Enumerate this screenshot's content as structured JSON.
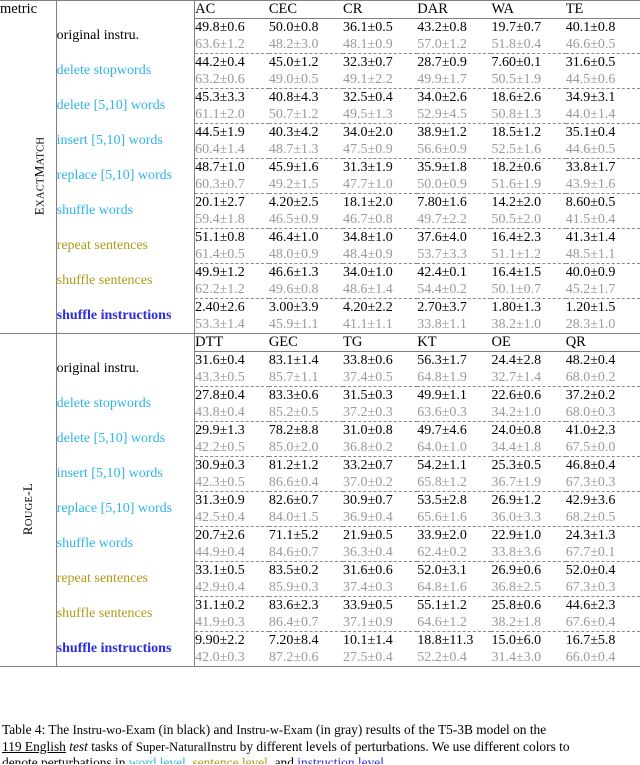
{
  "table": {
    "metric_header_label": "metric",
    "sections": [
      {
        "metric_label": "ExactMatch",
        "columns": [
          "AC",
          "CEC",
          "CR",
          "DAR",
          "WA",
          "TE"
        ],
        "rows": [
          {
            "label": "original instru.",
            "level": "none",
            "black": [
              "49.8±0.6",
              "50.0±0.8",
              "36.1±0.5",
              "43.2±0.8",
              "19.7±0.7",
              "40.1±0.8"
            ],
            "gray": [
              "63.6±1.2",
              "48.2±3.0",
              "48.1±0.9",
              "57.0±1.2",
              "51.8±0.4",
              "46.6±0.5"
            ]
          },
          {
            "label": "delete stopwords",
            "level": "word",
            "black": [
              "44.2±0.4",
              "45.0±1.2",
              "32.3±0.7",
              "28.7±0.9",
              "7.60±0.1",
              "31.6±0.5"
            ],
            "gray": [
              "63.2±0.6",
              "49.0±0.5",
              "49.1±2.2",
              "49.9±1.7",
              "50.5±1.9",
              "44.5±0.6"
            ]
          },
          {
            "label": "delete [5,10] words",
            "level": "word",
            "black": [
              "45.3±3.3",
              "40.8±4.3",
              "32.5±0.4",
              "34.0±2.6",
              "18.6±2.6",
              "34.9±3.1"
            ],
            "gray": [
              "61.1±2.0",
              "50.7±1.2",
              "49.5±1.3",
              "52.9±4.5",
              "50.8±1.3",
              "44.0±1.4"
            ]
          },
          {
            "label": "insert [5,10] words",
            "level": "word",
            "black": [
              "44.5±1.9",
              "40.3±4.2",
              "34.0±2.0",
              "38.9±1.2",
              "18.5±1.2",
              "35.1±0.4"
            ],
            "gray": [
              "60.4±1.4",
              "48.7±1.3",
              "47.5±0.9",
              "56.6±0.9",
              "52.5±1.6",
              "44.6±0.5"
            ]
          },
          {
            "label": "replace [5,10] words",
            "level": "word",
            "black": [
              "48.7±1.0",
              "45.9±1.6",
              "31.3±1.9",
              "35.9±1.8",
              "18.2±0.6",
              "33.8±1.7"
            ],
            "gray": [
              "60.3±0.7",
              "49.2±1.5",
              "47.7±1.0",
              "50.0±0.9",
              "51.6±1.9",
              "43.9±1.6"
            ]
          },
          {
            "label": "shuffle words",
            "level": "word",
            "black": [
              "20.1±2.7",
              "4.20±2.5",
              "18.1±2.0",
              "7.80±1.6",
              "14.2±2.0",
              "8.60±0.5"
            ],
            "gray": [
              "59.4±1.8",
              "46.5±0.9",
              "46.7±0.8",
              "49.7±2.2",
              "50.5±2.0",
              "41.5±0.4"
            ]
          },
          {
            "label": "repeat sentences",
            "level": "sent",
            "black": [
              "51.1±0.8",
              "46.4±1.0",
              "34.8±1.0",
              "37.6±4.0",
              "16.4±2.3",
              "41.3±1.4"
            ],
            "gray": [
              "61.4±0.5",
              "48.0±0.9",
              "48.4±0.9",
              "53.7±3.3",
              "51.1±1.2",
              "48.5±1.1"
            ]
          },
          {
            "label": "shuffle sentences",
            "level": "sent",
            "black": [
              "49.9±1.2",
              "46.6±1.3",
              "34.0±1.0",
              "42.4±0.1",
              "16.4±1.5",
              "40.0±0.9"
            ],
            "gray": [
              "62.2±1.2",
              "49.6±0.8",
              "48.6±1.4",
              "54.4±0.2",
              "50.1±0.7",
              "45.2±1.7"
            ]
          },
          {
            "label": "shuffle instructions",
            "level": "instr",
            "black": [
              "2.40±2.6",
              "3.00±3.9",
              "4.20±2.2",
              "2.70±3.7",
              "1.80±1.3",
              "1.20±1.5"
            ],
            "gray": [
              "53.3±1.4",
              "45.9±1.1",
              "41.1±1.1",
              "33.8±1.1",
              "38.2±1.0",
              "28.3±1.0"
            ]
          }
        ]
      },
      {
        "metric_label": "Rouge-L",
        "columns": [
          "DTT",
          "GEC",
          "TG",
          "KT",
          "OE",
          "QR"
        ],
        "rows": [
          {
            "label": "original instru.",
            "level": "none",
            "black": [
              "31.6±0.4",
              "83.1±1.4",
              "33.8±0.6",
              "56.3±1.7",
              "24.4±2.8",
              "48.2±0.4"
            ],
            "gray": [
              "43.3±0.5",
              "85.7±1.1",
              "37.4±0.5",
              "64.8±1.9",
              "32.7±1.4",
              "68.0±0.2"
            ]
          },
          {
            "label": "delete stopwords",
            "level": "word",
            "black": [
              "27.8±0.4",
              "83.3±0.6",
              "31.5±0.3",
              "49.9±1.1",
              "22.6±0.6",
              "37.2±0.2"
            ],
            "gray": [
              "43.8±0.4",
              "85.2±0.5",
              "37.2±0.3",
              "63.6±0.3",
              "34.2±1.0",
              "68.0±0.3"
            ]
          },
          {
            "label": "delete [5,10] words",
            "level": "word",
            "black": [
              "29.9±1.3",
              "78.2±8.8",
              "31.0±0.8",
              "49.7±4.6",
              "24.0±0.8",
              "41.0±2.3"
            ],
            "gray": [
              "42.2±0.5",
              "85.0±2.0",
              "36.8±0.2",
              "64.0±1.0",
              "34.4±1.8",
              "67.5±0.0"
            ]
          },
          {
            "label": "insert [5,10] words",
            "level": "word",
            "black": [
              "30.9±0.3",
              "81.2±1.2",
              "33.2±0.7",
              "54.2±1.1",
              "25.3±0.5",
              "46.8±0.4"
            ],
            "gray": [
              "42.3±0.5",
              "86.6±0.4",
              "37.0±0.2",
              "65.8±1.2",
              "36.7±1.9",
              "67.3±0.3"
            ]
          },
          {
            "label": "replace [5,10] words",
            "level": "word",
            "black": [
              "31.3±0.9",
              "82.6±0.7",
              "30.9±0.7",
              "53.5±2.8",
              "26.9±1.2",
              "42.9±3.6"
            ],
            "gray": [
              "42.5±0.4",
              "84.0±1.5",
              "36.9±0.4",
              "65.6±1.6",
              "36.0±3.3",
              "68.2±0.5"
            ]
          },
          {
            "label": "shuffle words",
            "level": "word",
            "black": [
              "20.7±2.6",
              "71.1±5.2",
              "21.9±0.5",
              "33.9±2.0",
              "22.9±1.0",
              "24.3±1.3"
            ],
            "gray": [
              "44.9±0.4",
              "84.6±0.7",
              "36.3±0.4",
              "62.4±0.2",
              "33.8±3.6",
              "67.7±0.1"
            ]
          },
          {
            "label": "repeat sentences",
            "level": "sent",
            "black": [
              "33.1±0.5",
              "83.5±0.2",
              "31.6±0.6",
              "52.0±3.1",
              "26.9±0.6",
              "52.0±0.4"
            ],
            "gray": [
              "42.9±0.4",
              "85.9±0.3",
              "37.4±0.3",
              "64.8±1.6",
              "36.8±2.5",
              "67.3±0.3"
            ]
          },
          {
            "label": "shuffle sentences",
            "level": "sent",
            "black": [
              "31.1±0.2",
              "83.6±2.3",
              "33.9±0.5",
              "55.1±1.2",
              "25.8±0.6",
              "44.6±2.3"
            ],
            "gray": [
              "41.9±0.3",
              "86.4±0.7",
              "37.1±0.9",
              "64.6±1.2",
              "38.2±1.8",
              "67.6±0.4"
            ]
          },
          {
            "label": "shuffle instructions",
            "level": "instr",
            "black": [
              "9.90±2.2",
              "7.20±8.4",
              "10.1±1.4",
              "18.8±11.3",
              "15.0±6.0",
              "16.7±5.8"
            ],
            "gray": [
              "42.0±0.3",
              "87.2±0.6",
              "27.5±0.4",
              "52.2±0.4",
              "31.4±3.0",
              "66.0±0.4"
            ]
          }
        ]
      }
    ]
  },
  "caption": {
    "number": "Table 4:",
    "line1_a": "The",
    "kw_instru_wo_exam": "Instru-wo-Exam",
    "line1_b": "(in black) and",
    "kw_instru_w_exam": "Instru-w-Exam",
    "line1_c": "(in gray) results of the T5-3B model on the",
    "line2_a": "119 English",
    "line2_italic": "test",
    "line2_b": "tasks of",
    "kw_supernat": "Super-NaturalInstru",
    "line2_c": "by different levels of perturbations. We use different colors to",
    "line3_a": "denote perturbations in",
    "line3_word": "word level",
    "line3_mid1": ",",
    "line3_sent": "sentence level",
    "line3_mid2": ", and",
    "line3_instr": "instruction level",
    "line3_end": "."
  },
  "colors": {
    "word_level": "#2fb4e9",
    "sentence_level": "#b09a18",
    "instruction_level": "#2b2be0",
    "gray_value": "#9a9a9a",
    "rule": "#808080"
  }
}
